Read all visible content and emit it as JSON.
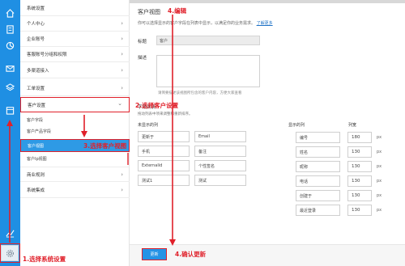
{
  "rail": {
    "icons": [
      "home-icon",
      "document-icon",
      "chart-icon",
      "mail-icon",
      "stack-icon",
      "calendar-icon",
      "analytics-icon"
    ],
    "settings_icon": "gear-icon"
  },
  "menu": {
    "header": "系统设置",
    "items": [
      {
        "label": "个人中心"
      },
      {
        "label": "企业账号"
      },
      {
        "label": "客服账号分组和权限"
      },
      {
        "label": "多渠道接入"
      },
      {
        "label": "工单设置"
      },
      {
        "label": "客户设置"
      }
    ],
    "sub_items": [
      "客户字段",
      "客户产品字段",
      "客户视图",
      "客户Ip视图"
    ],
    "bottom_items": [
      {
        "label": "商业规则"
      },
      {
        "label": "系统集成"
      }
    ]
  },
  "main": {
    "title": "客户视图",
    "desc": "你可以选择显示的客户字段在列表中显示，以满足你的业务需求。",
    "desc_link": "了解更多",
    "title_label": "标题",
    "title_value": "客户",
    "desc_label": "描述",
    "desc_hint": "请简要描述该视图所包含的客户内容，方便大家查看",
    "fields_title": "字段列表",
    "fields_sub": "拖动列表中项来调整和重新排序。",
    "hidden_head": "未显示的列",
    "shown_head": "显示的列",
    "width_head": "列宽",
    "hidden_fields": [
      [
        "更新于",
        "Email"
      ],
      [
        "手机",
        "备注"
      ],
      [
        "Externalid",
        "个性签名"
      ],
      [
        "测试1",
        "测试"
      ]
    ],
    "shown_fields": [
      {
        "name": "编号",
        "width": "180",
        "unit": "px"
      },
      {
        "name": "姓名",
        "width": "130",
        "unit": "px"
      },
      {
        "name": "昵称",
        "width": "130",
        "unit": "px"
      },
      {
        "name": "电话",
        "width": "130",
        "unit": "px"
      },
      {
        "name": "创建于",
        "width": "130",
        "unit": "px"
      },
      {
        "name": "最近登录",
        "width": "130",
        "unit": "px"
      }
    ],
    "update_button": "更新"
  },
  "annotations": {
    "step1": "1.选择系统设置",
    "step2": "2.选择客户设置",
    "step3": "3.选择客户视图",
    "step4_edit": "4.编辑",
    "step4_confirm": "4.确认更新"
  },
  "colors": {
    "rail": "#1f8fe3",
    "accent": "#2e9ae5",
    "annotation": "#e0202a"
  }
}
